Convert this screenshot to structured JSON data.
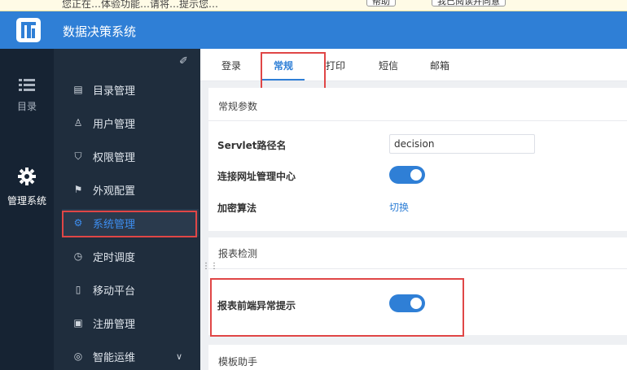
{
  "notice": {
    "text": "您正在…体验功能…请将…提示您…",
    "btn1": "帮助",
    "btn2": "我已阅读并同意"
  },
  "header": {
    "title": "数据决策系统",
    "logo_icon": "fr-logo-icon"
  },
  "rail": [
    {
      "label": "目录",
      "icon": "list-icon"
    },
    {
      "label": "管理系统",
      "icon": "gear-icon"
    }
  ],
  "menu": {
    "items": [
      {
        "label": "目录管理",
        "icon": "list-box-icon"
      },
      {
        "label": "用户管理",
        "icon": "user-list-icon"
      },
      {
        "label": "权限管理",
        "icon": "shield-icon"
      },
      {
        "label": "外观配置",
        "icon": "paint-icon"
      },
      {
        "label": "系统管理",
        "icon": "gear-icon"
      },
      {
        "label": "定时调度",
        "icon": "timer-icon"
      },
      {
        "label": "移动平台",
        "icon": "phone-icon"
      },
      {
        "label": "注册管理",
        "icon": "register-icon"
      },
      {
        "label": "智能运维",
        "icon": "ops-icon"
      }
    ],
    "active_index": 4
  },
  "tabs": [
    "登录",
    "常规",
    "打印",
    "短信",
    "邮箱"
  ],
  "active_tab": 1,
  "section_general": {
    "title": "常规参数",
    "servlet_label": "Servlet路径名",
    "servlet_value": "decision",
    "connect_label": "连接网址管理中心",
    "connect_on": true,
    "encrypt_label": "加密算法",
    "encrypt_link": "切换"
  },
  "section_report": {
    "title": "报表检测",
    "frontend_label": "报表前端异常提示",
    "frontend_on": true
  },
  "section_template": {
    "title": "模板助手"
  },
  "colors": {
    "accent": "#2f7fd6",
    "highlight": "#e04646",
    "sidebar": "#1f2d3d"
  }
}
